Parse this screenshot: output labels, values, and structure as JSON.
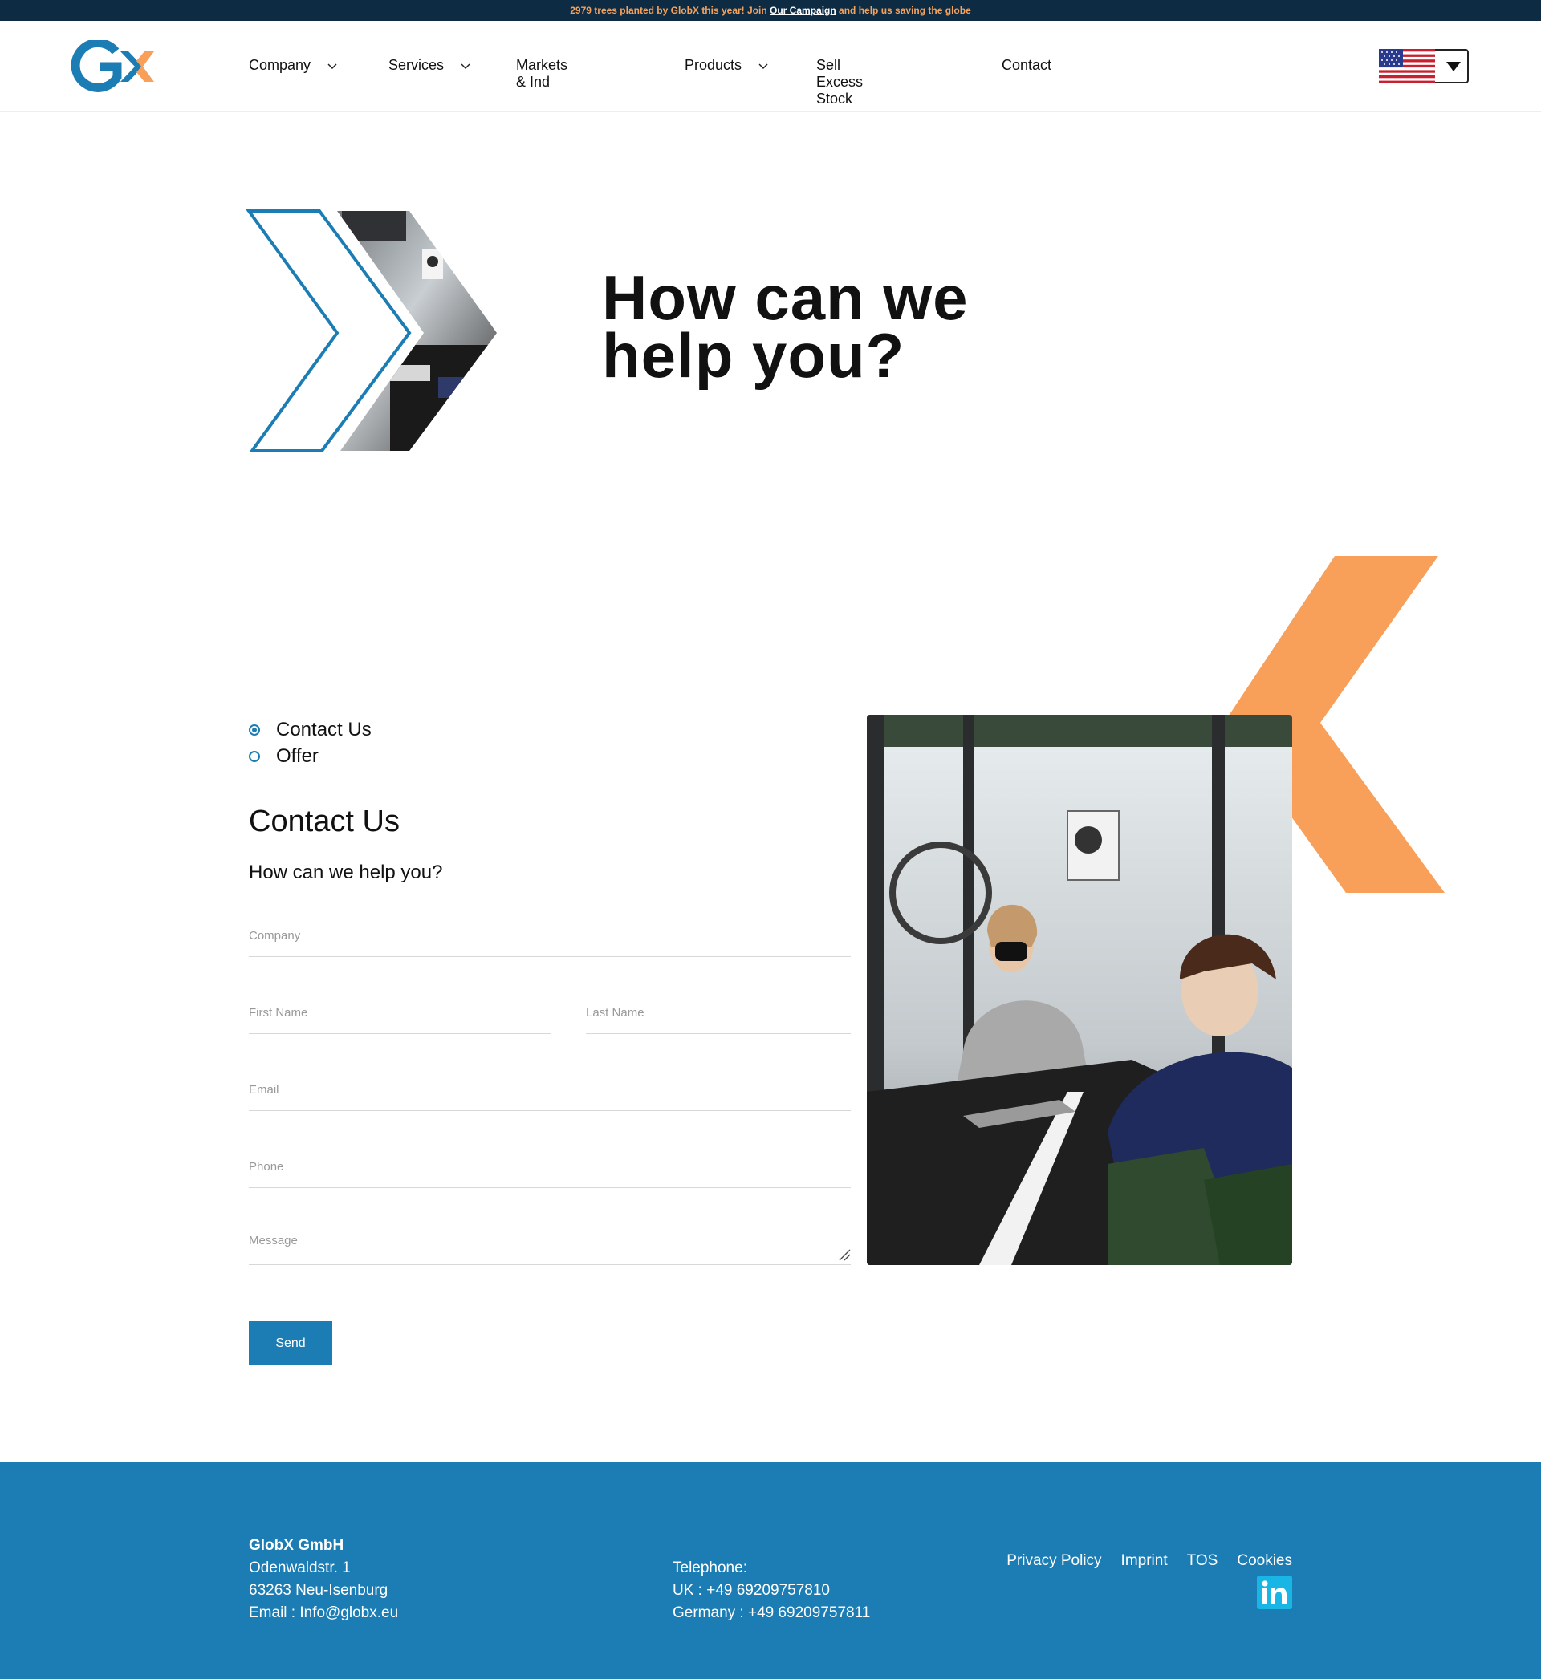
{
  "banner": {
    "text_before": "2979 trees planted by GlobX this year! Join",
    "link": "Our Campaign",
    "text_after": "and help us saving the globe"
  },
  "header": {
    "logo_alt": "GX",
    "nav": [
      {
        "label": "Company",
        "has_dropdown": true
      },
      {
        "label": "Services",
        "has_dropdown": true
      },
      {
        "label": "Markets & Ind",
        "has_dropdown": false
      },
      {
        "label": "Products",
        "has_dropdown": true
      },
      {
        "label": "Sell Excess Stock",
        "has_dropdown": false
      },
      {
        "label": "Contact",
        "has_dropdown": false
      }
    ],
    "language_flag": "us-flag-icon"
  },
  "hero": {
    "title_line1": "How can we",
    "title_line2": "help you?"
  },
  "form": {
    "radio_options": [
      {
        "label": "Contact Us",
        "selected": true
      },
      {
        "label": "Offer",
        "selected": false
      }
    ],
    "title": "Contact Us",
    "subtitle": "How can we help you?",
    "placeholders": {
      "company": "Company",
      "first_name": "First Name",
      "last_name": "Last Name",
      "email": "Email",
      "phone": "Phone",
      "message": "Message"
    },
    "send_label": "Send"
  },
  "footer": {
    "company_name": "GlobX GmbH",
    "address_line1": "Odenwaldstr. 1",
    "address_line2": "63263 Neu-Isenburg",
    "email": "Email : Info@globx.eu",
    "telephone_label": "Telephone:",
    "phone_uk": "UK : +49 69209757810",
    "phone_de": "Germany : +49 69209757811",
    "links": [
      "Privacy Policy",
      "Imprint",
      "TOS",
      "Cookies"
    ],
    "social_icon": "linkedin-icon"
  },
  "colors": {
    "brand_blue": "#1c7db4",
    "brand_orange": "#f8a05a",
    "banner_bg": "#0d2c44"
  }
}
